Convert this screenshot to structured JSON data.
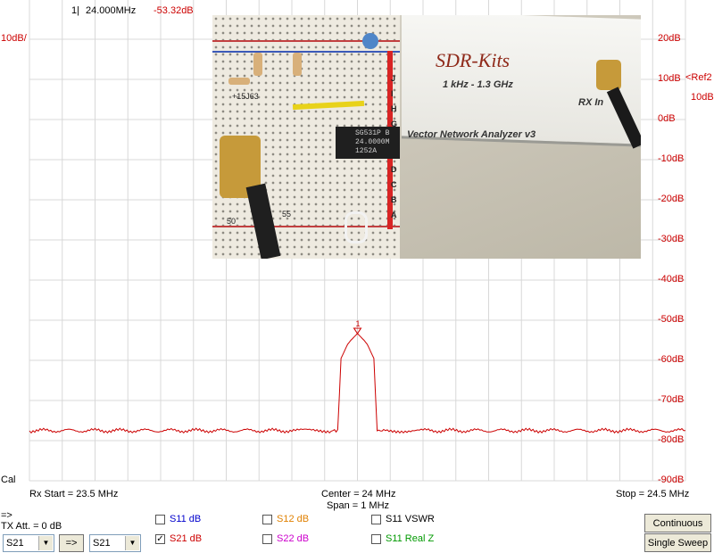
{
  "header": {
    "marker_num": "1",
    "marker_freq": "24.000MHz",
    "marker_val": "-53.32dB",
    "scale_left": "10dB/",
    "ref_label": "<Ref2",
    "ref_value": "10dB"
  },
  "colors": {
    "trace": "#cc0000",
    "grid": "#d8d8d8",
    "axis_text": "#cc0000"
  },
  "y_ticks": [
    "20dB",
    "10dB",
    "0dB",
    "-10dB",
    "-20dB",
    "-30dB",
    "-40dB",
    "-50dB",
    "-60dB",
    "-70dB",
    "-80dB",
    "-90dB"
  ],
  "chart_data": {
    "type": "line",
    "title": "",
    "xlabel": "",
    "ylabel": "",
    "xlim": [
      23.5,
      24.5
    ],
    "ylim": [
      -90,
      20
    ],
    "grid": true,
    "series": [
      {
        "name": "S21",
        "x": [
          23.5,
          23.6,
          23.7,
          23.8,
          23.9,
          23.96,
          23.97,
          23.975,
          23.985,
          23.99,
          24.0,
          24.01,
          24.015,
          24.025,
          24.03,
          24.04,
          24.1,
          24.2,
          24.3,
          24.4,
          24.5
        ],
        "y": [
          -77.5,
          -77.5,
          -77.5,
          -77.5,
          -77.5,
          -77.5,
          -77.5,
          -59.5,
          -56.0,
          -55.0,
          -53.3,
          -55.0,
          -56.0,
          -59.5,
          -77.5,
          -77.5,
          -77.5,
          -77.5,
          -77.5,
          -77.5,
          -77.5
        ]
      }
    ],
    "marker": {
      "label": "1",
      "x": 24.0,
      "y": -53.32
    }
  },
  "bottom": {
    "cal": "Cal",
    "rx_start": "Rx Start = 23.5 MHz",
    "center": "Center = 24 MHz",
    "span": "Span = 1 MHz",
    "stop": "Stop = 24.5 MHz"
  },
  "controls": {
    "arrow_label": "=>",
    "tx_att": "TX Att.  = 0 dB",
    "select_left": "S21",
    "select_right": "S21",
    "arrow_button": "=>",
    "checks": [
      {
        "label": "S11  dB",
        "checked": false,
        "color": "#0000cc"
      },
      {
        "label": "S21  dB",
        "checked": true,
        "color": "#cc0000"
      },
      {
        "label": "S12  dB",
        "checked": false,
        "color": "#e08000"
      },
      {
        "label": "S22  dB",
        "checked": false,
        "color": "#cc00cc"
      },
      {
        "label": "S11  VSWR",
        "checked": false,
        "color": "#000000"
      },
      {
        "label": "S11  Real Z",
        "checked": false,
        "color": "#009900"
      }
    ],
    "continuous": "Continuous",
    "single_sweep": "Single Sweep"
  },
  "photo": {
    "brand": "SDR-Kits",
    "range": "1 kHz - 1.3 GHz",
    "rx_in": "RX In",
    "product": "Vector Network Analyzer v3",
    "chip_lines": [
      "SG531P  B",
      "24.0000M",
      "1252A"
    ],
    "board_cols": [
      "J",
      "I",
      "H",
      "G",
      "F",
      "E",
      "D",
      "C",
      "B",
      "A"
    ],
    "row_50": "50",
    "row_55": "55",
    "resistor_code": "+15J63"
  }
}
